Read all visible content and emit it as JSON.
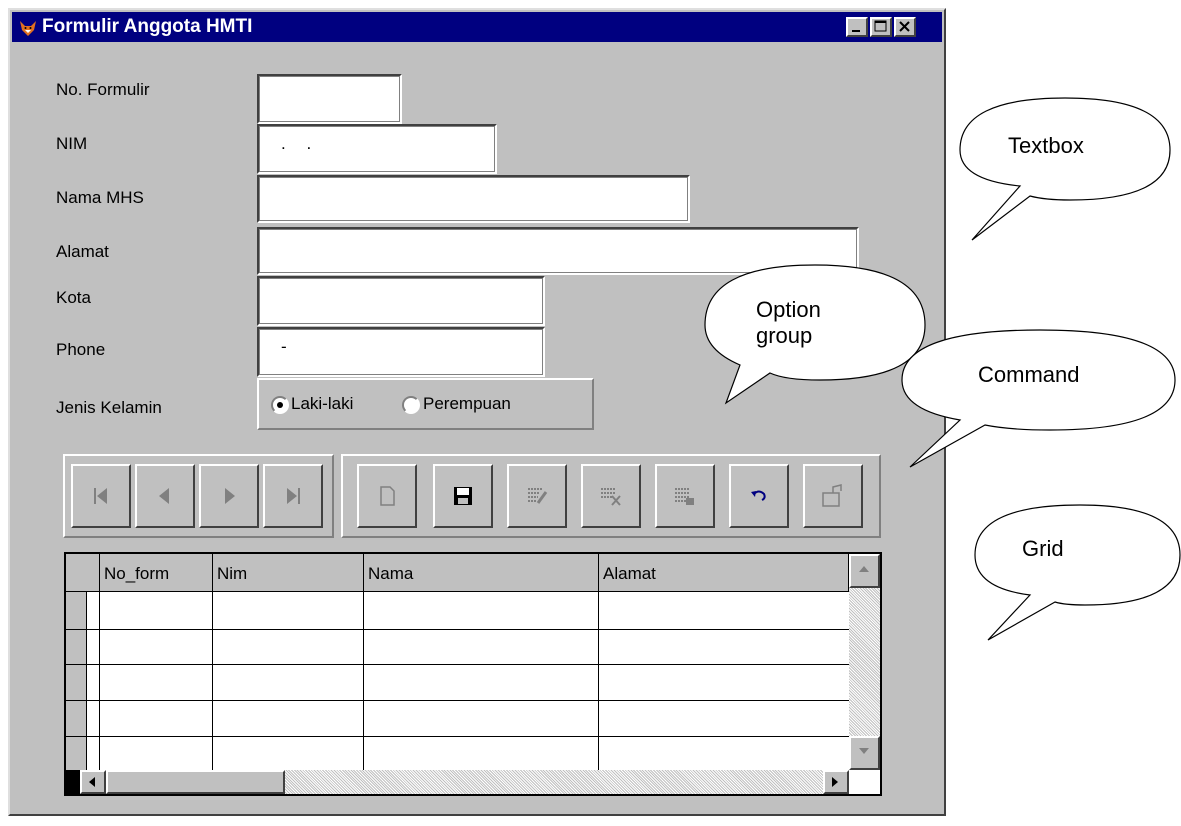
{
  "window": {
    "title": "Formulir Anggota HMTI"
  },
  "form": {
    "no_formulir_label": "No. Formulir",
    "nim_label": "NIM",
    "nim_value": ". .",
    "nama_label": "Nama MHS",
    "alamat_label": "Alamat",
    "kota_label": "Kota",
    "phone_label": "Phone",
    "phone_value": "-",
    "jenis_kelamin_label": "Jenis Kelamin",
    "options": [
      "Laki-laki",
      "Perempuan"
    ],
    "selected_option": "Laki-laki"
  },
  "grid": {
    "columns": [
      "No_form",
      "Nim",
      "Nama",
      "Alamat"
    ]
  },
  "callouts": {
    "textbox": "Textbox",
    "option_group_line1": "Option",
    "option_group_line2": "group",
    "command": "Command",
    "grid": "Grid"
  },
  "icons": {
    "nav": [
      "first-record-icon",
      "prev-record-icon",
      "next-record-icon",
      "last-record-icon"
    ],
    "commands": [
      "new-icon",
      "save-icon",
      "edit-icon",
      "delete-icon",
      "find-icon",
      "undo-icon",
      "exit-icon"
    ]
  }
}
